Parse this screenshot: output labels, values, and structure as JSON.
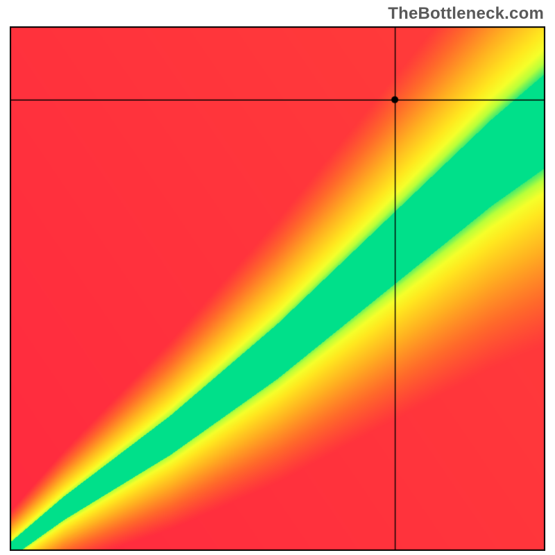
{
  "attribution": "TheBottleneck.com",
  "chart_data": {
    "type": "heatmap",
    "title": "",
    "xlabel": "",
    "ylabel": "",
    "xlim": [
      0,
      100
    ],
    "ylim": [
      0,
      100
    ],
    "crosshair": {
      "x": 72,
      "y": 86
    },
    "marker": {
      "x": 72,
      "y": 86
    },
    "curve": {
      "description": "optimal pairing band (diagonal ridge, slightly super-linear)",
      "points": [
        {
          "x": 0,
          "y": 0
        },
        {
          "x": 10,
          "y": 8
        },
        {
          "x": 20,
          "y": 15
        },
        {
          "x": 30,
          "y": 22
        },
        {
          "x": 40,
          "y": 30
        },
        {
          "x": 50,
          "y": 38
        },
        {
          "x": 60,
          "y": 47
        },
        {
          "x": 70,
          "y": 56
        },
        {
          "x": 80,
          "y": 65
        },
        {
          "x": 90,
          "y": 74
        },
        {
          "x": 100,
          "y": 82
        }
      ],
      "band_half_width_start": 1.5,
      "band_half_width_end": 9
    },
    "color_stops": [
      {
        "t": 0.0,
        "color": "#ff2a3f"
      },
      {
        "t": 0.25,
        "color": "#ff6a2a"
      },
      {
        "t": 0.5,
        "color": "#ffb020"
      },
      {
        "t": 0.72,
        "color": "#ffe81f"
      },
      {
        "t": 0.82,
        "color": "#f6ff2a"
      },
      {
        "t": 0.9,
        "color": "#b8ff3a"
      },
      {
        "t": 1.0,
        "color": "#00e08a"
      }
    ]
  }
}
